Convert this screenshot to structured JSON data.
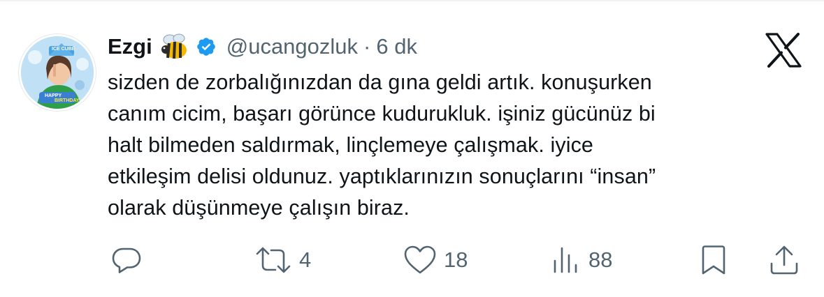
{
  "author": {
    "name": "Ezgi",
    "emoji_icon": "bee-emoji",
    "verified_icon": "verified-badge-icon",
    "handle": "@ucangozluk",
    "separator": "·",
    "time": "6 dk",
    "avatar_image_text": [
      "ICE CUBE",
      "HAPPY",
      "BIRTHDAY"
    ]
  },
  "tweet": {
    "lines": [
      "sizden de zorbalığınızdan da gına geldi artık. konuşurken",
      "canım cicim, başarı görünce kudurukluk. işiniz gücünüz bi",
      "halt bilmeden saldırmak, linçlemeye çalışmak. iyice",
      "etkileşim delisi oldunuz. yaptıklarınızın sonuçlarını “insan”",
      "olarak düşünmeye çalışın biraz."
    ]
  },
  "actions": {
    "reply": {
      "icon": "reply-icon",
      "count": ""
    },
    "retweet": {
      "icon": "retweet-icon",
      "count": "4"
    },
    "like": {
      "icon": "heart-icon",
      "count": "18"
    },
    "views": {
      "icon": "views-icon",
      "count": "88"
    },
    "bookmark": {
      "icon": "bookmark-icon"
    },
    "share": {
      "icon": "share-icon"
    }
  },
  "brand": {
    "logo": "x-logo-icon"
  },
  "colors": {
    "text": "#0f1419",
    "secondary": "#536471",
    "verified": "#1d9bf0",
    "background": "#ffffff"
  }
}
